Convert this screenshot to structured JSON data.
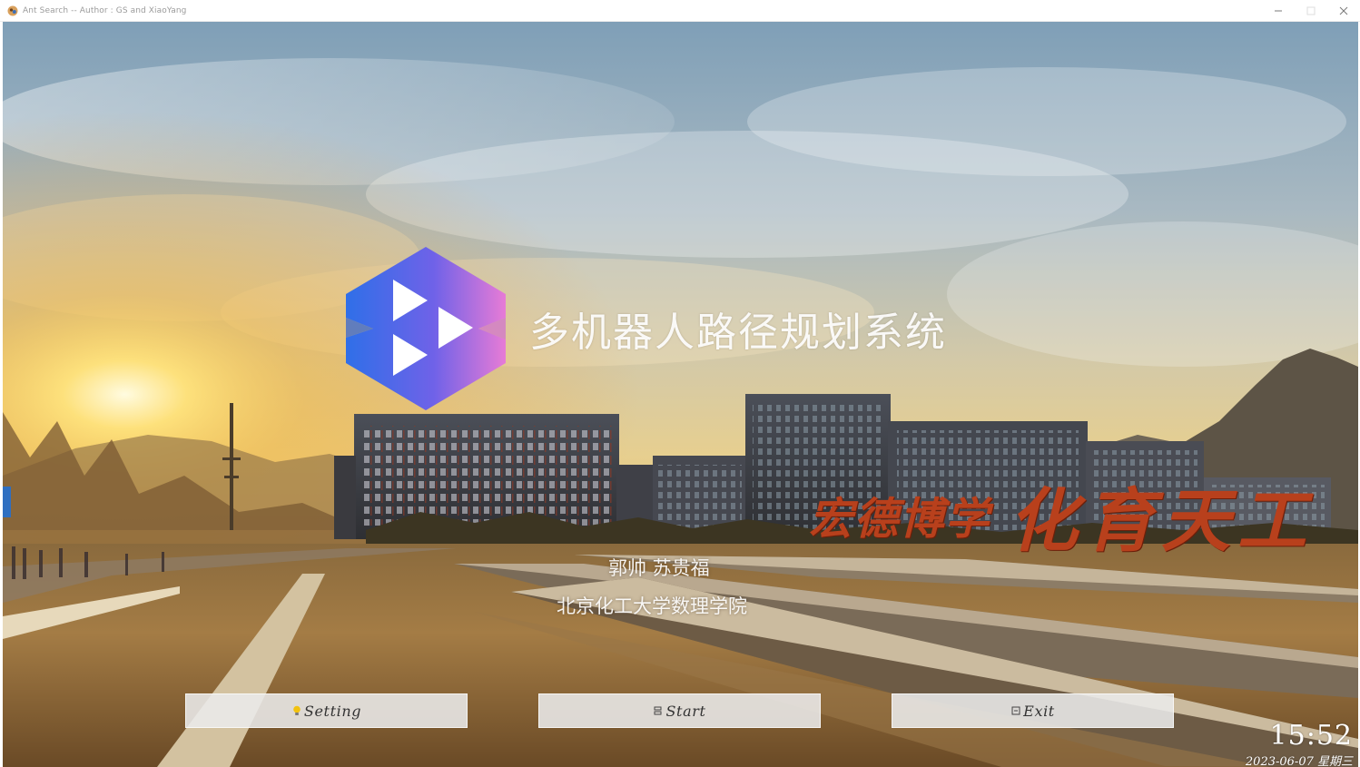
{
  "window": {
    "title": "Ant Search -- Author : GS and XiaoYang",
    "controls": {
      "minimize_icon": "minimize-icon",
      "maximize_icon": "maximize-icon",
      "close_icon": "close-icon"
    }
  },
  "main": {
    "app_title": "多机器人路径规划系统",
    "authors": "郭帅 苏贵福",
    "affiliation": "北京化工大学数理学院",
    "motto_left": "宏德博学",
    "motto_right": "化育天工"
  },
  "buttons": {
    "setting": {
      "label": "Setting",
      "icon": "lightbulb-icon"
    },
    "start": {
      "label": "Start",
      "icon": "start-icon"
    },
    "exit": {
      "label": "Exit",
      "icon": "exit-icon"
    }
  },
  "status": {
    "time": "15:52",
    "date": "2023-06-07 星期三"
  },
  "colors": {
    "logo_blue": "#2f6fe8",
    "logo_pink": "#e77bd6",
    "motto_red": "#b8401c",
    "button_bg": "#ebebeb"
  }
}
